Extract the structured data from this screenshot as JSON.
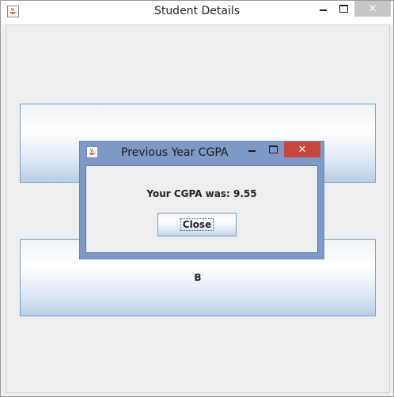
{
  "main_window": {
    "title": "Student Details",
    "app_icon": "java-cup-icon",
    "controls": {
      "minimize_icon": "minimize-icon",
      "maximize_icon": "maximize-icon",
      "close_label": "✕"
    },
    "buttons": [
      {
        "label": ""
      },
      {
        "label": "B"
      }
    ]
  },
  "dialog": {
    "title": "Previous Year CGPA",
    "app_icon": "java-cup-icon",
    "message": "Your CGPA was: 9.55",
    "close_button_label": "Close",
    "controls": {
      "minimize_icon": "minimize-icon",
      "maximize_icon": "maximize-icon",
      "close_label": "✕"
    },
    "colors": {
      "frame": "#7e99c5",
      "close": "#c9463d"
    }
  }
}
